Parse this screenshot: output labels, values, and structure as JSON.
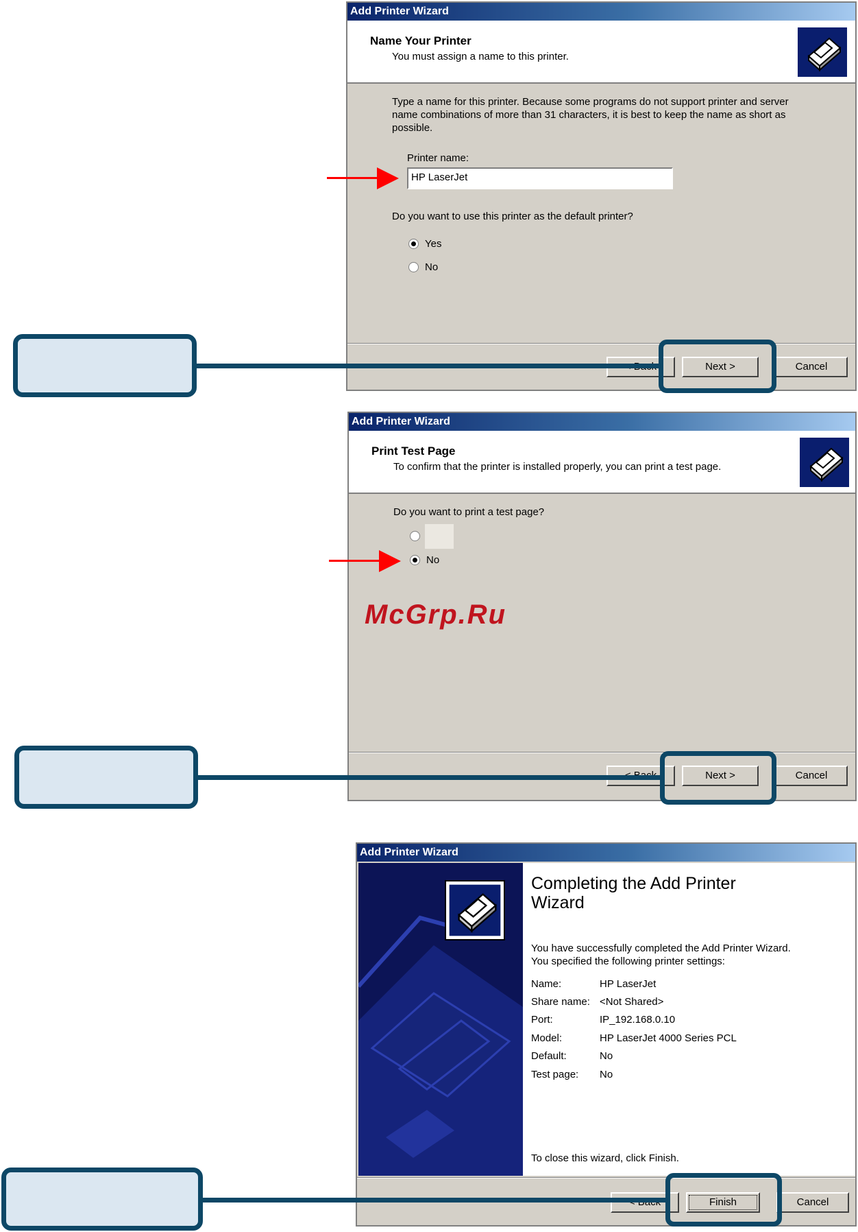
{
  "dialog1": {
    "title": "Add Printer Wizard",
    "header_title": "Name Your Printer",
    "header_subtitle": "You must assign a name to this printer.",
    "intro_lines": [
      "Type a name for this printer. Because some programs do not support printer and server",
      "name combinations of more than 31 characters, it is best to keep the name as short as",
      "possible."
    ],
    "printer_name_label": "Printer name:",
    "printer_name_value": "HP LaserJet",
    "default_question": "Do you want to use this printer as the default printer?",
    "radio_yes": "Yes",
    "radio_no": "No",
    "back_button": "< Back",
    "next_button": "Next >",
    "cancel_button": "Cancel"
  },
  "dialog2": {
    "title": "Add Printer Wizard",
    "header_title": "Print Test Page",
    "header_subtitle": "To confirm that the printer is installed properly, you can print a test page.",
    "question": "Do you want to print a test page?",
    "radio_no": "No",
    "back_button": "< Back",
    "next_button": "Next >",
    "cancel_button": "Cancel"
  },
  "watermark": "McGrp.Ru",
  "dialog3": {
    "title": "Add Printer Wizard",
    "heading_line1": "Completing the Add Printer",
    "heading_line2": "Wizard",
    "success_line1": "You have successfully completed the Add Printer Wizard.",
    "success_line2": "You specified the following printer settings:",
    "settings": [
      {
        "label": "Name:",
        "value": "HP LaserJet"
      },
      {
        "label": "Share name:",
        "value": "<Not Shared>"
      },
      {
        "label": "Port:",
        "value": "IP_192.168.0.10"
      },
      {
        "label": "Model:",
        "value": "HP LaserJet 4000 Series PCL"
      },
      {
        "label": "Default:",
        "value": "No"
      },
      {
        "label": "Test page:",
        "value": "No"
      }
    ],
    "close_hint": "To close this wizard, click Finish.",
    "back_button": "< Back",
    "finish_button": "Finish",
    "cancel_button": "Cancel"
  },
  "icons": [
    "printer-wizard-icon",
    "red-arrow-icon"
  ],
  "colors": {
    "callout_border": "#0d4766",
    "callout_fill": "#dbe7f1",
    "arrow": "#ff0000",
    "titlebar": "#0a246a"
  }
}
